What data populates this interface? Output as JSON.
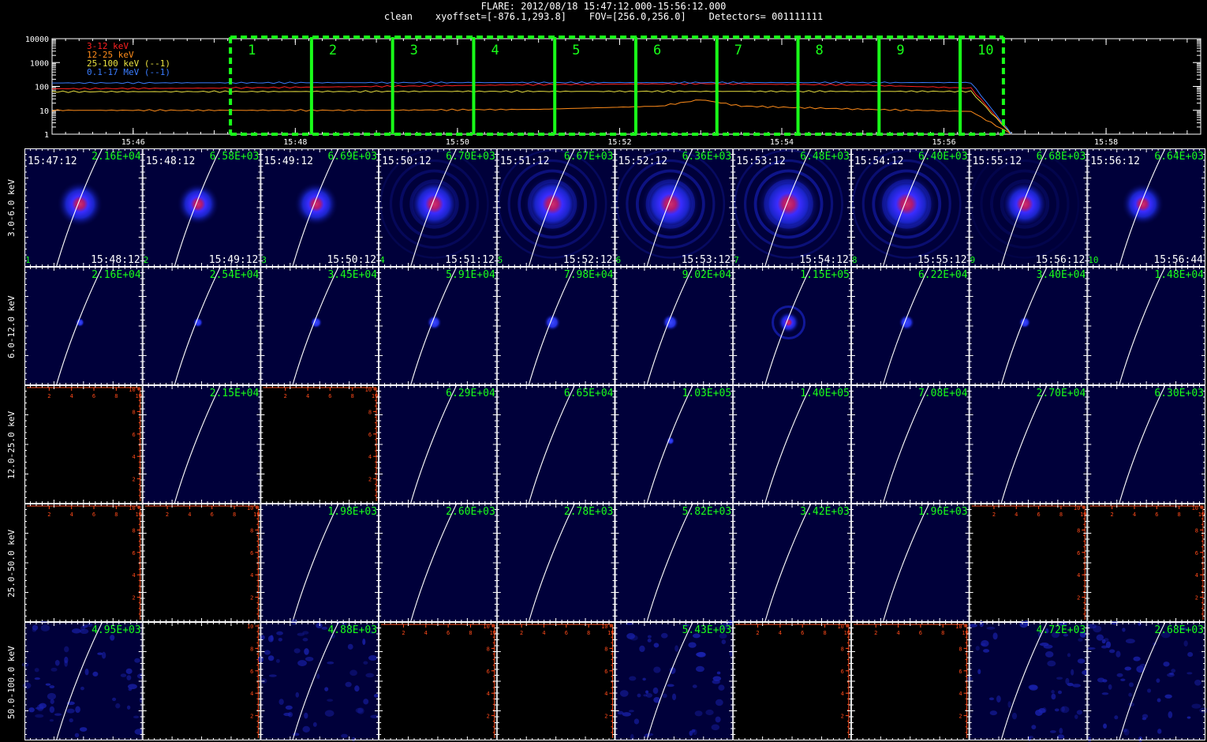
{
  "header": {
    "line1": "FLARE: 2012/08/18 15:47:12.000-15:56:12.000",
    "line2": "clean    xyoffset=[-876.1,293.8]    FOV=[256.0,256.0]    Detectors= 001111111"
  },
  "lightcurve": {
    "y_ticks": [
      "10000",
      "1000",
      "100",
      "10",
      "1"
    ],
    "x_ticks": [
      "15:46",
      "15:48",
      "15:50",
      "15:52",
      "15:54",
      "15:56",
      "15:58"
    ],
    "legend": [
      {
        "label": "3-12 keV",
        "color": "#ff2020"
      },
      {
        "label": "12-25 keV",
        "color": "#ff8c1a"
      },
      {
        "label": "25-100 keV (--1)",
        "color": "#e8e040"
      },
      {
        "label": "0.1-17 MeV (--1)",
        "color": "#3a7cff"
      }
    ],
    "intervals": [
      "1",
      "2",
      "3",
      "4",
      "5",
      "6",
      "7",
      "8",
      "9",
      "10"
    ],
    "interval_color": "#19ff19"
  },
  "chart_data": {
    "type": "line",
    "title": "FLARE: 2012/08/18 15:47:12.000-15:56:12.000",
    "yscale": "log",
    "ylim": [
      1,
      10000
    ],
    "xlim": [
      "15:45:00",
      "15:59:10"
    ],
    "series": [
      {
        "name": "3-12 keV",
        "color": "#ff2020",
        "x": [
          "15:45",
          "15:47",
          "15:49",
          "15:51",
          "15:53",
          "15:55",
          "15:56:20",
          "15:56:50"
        ],
        "values": [
          80,
          85,
          100,
          120,
          130,
          115,
          85,
          1
        ]
      },
      {
        "name": "12-25 keV",
        "color": "#ff8c1a",
        "x": [
          "15:45",
          "15:47",
          "15:49",
          "15:51",
          "15:52:30",
          "15:53",
          "15:53:30",
          "15:55",
          "15:56:20",
          "15:56:50"
        ],
        "values": [
          10,
          10,
          10,
          11,
          15,
          28,
          15,
          11,
          9,
          1
        ]
      },
      {
        "name": "25-100 keV (--1)",
        "color": "#e8e040",
        "x": [
          "15:45",
          "15:50",
          "15:56:20",
          "15:56:50"
        ],
        "values": [
          60,
          62,
          62,
          1
        ]
      },
      {
        "name": "0.1-17 MeV (--1)",
        "color": "#3a7cff",
        "x": [
          "15:45",
          "15:50",
          "15:56:20",
          "15:56:50"
        ],
        "values": [
          140,
          145,
          145,
          1
        ]
      }
    ]
  },
  "images": {
    "time_starts": [
      "15:47:12",
      "15:48:12",
      "15:49:12",
      "15:50:12",
      "15:51:12",
      "15:52:12",
      "15:53:12",
      "15:54:12",
      "15:55:12",
      "15:56:12"
    ],
    "time_ends": [
      "15:48:12",
      "15:49:12",
      "15:50:12",
      "15:51:12",
      "15:52:12",
      "15:53:12",
      "15:54:12",
      "15:55:12",
      "15:56:12",
      "15:56:44"
    ],
    "rows": [
      {
        "label": "3.0-6.0 keV",
        "peaks": [
          "2.16E+04",
          "6.58E+03",
          "6.69E+03",
          "6.70E+03",
          "6.67E+03",
          "6.36E+03",
          "6.48E+03",
          "6.40E+03",
          "6.68E+03",
          "6.64E+03"
        ],
        "status": [
          1,
          1,
          1,
          1,
          1,
          1,
          1,
          1,
          1,
          1
        ]
      },
      {
        "label": "6.0-12.0 keV",
        "peaks": [
          "2.16E+04",
          "2.54E+04",
          "3.45E+04",
          "5.91E+04",
          "7.98E+04",
          "9.02E+04",
          "1.15E+05",
          "6.22E+04",
          "3.40E+04",
          "1.48E+04"
        ],
        "status": [
          1,
          1,
          1,
          1,
          1,
          1,
          1,
          1,
          1,
          1
        ]
      },
      {
        "label": "12.0-25.0 keV",
        "peaks": [
          "",
          "2.15E+04",
          "",
          "6.29E+04",
          "6.65E+04",
          "1.03E+05",
          "1.40E+05",
          "7.08E+04",
          "2.70E+04",
          "6.30E+03"
        ],
        "status": [
          0,
          1,
          0,
          1,
          1,
          1,
          1,
          1,
          1,
          1
        ]
      },
      {
        "label": "25.0-50.0 keV",
        "peaks": [
          "",
          "",
          "1.98E+03",
          "2.60E+03",
          "2.78E+03",
          "5.82E+03",
          "3.42E+03",
          "1.96E+03",
          "",
          ""
        ],
        "status": [
          0,
          0,
          1,
          1,
          1,
          1,
          1,
          1,
          0,
          0
        ]
      },
      {
        "label": "50.0-100.0 keV",
        "peaks": [
          "4.95E+03",
          "",
          "4.88E+03",
          "",
          "",
          "5.43E+03",
          "",
          "",
          "4.72E+03",
          "2.68E+03"
        ],
        "status": [
          1,
          0,
          1,
          0,
          0,
          1,
          0,
          0,
          1,
          1
        ]
      }
    ],
    "empty_axis_ticks": [
      "2",
      "4",
      "6",
      "8",
      "10"
    ],
    "peak_color": "#19ff19",
    "empty_axis_color": "#ff4a1a"
  }
}
